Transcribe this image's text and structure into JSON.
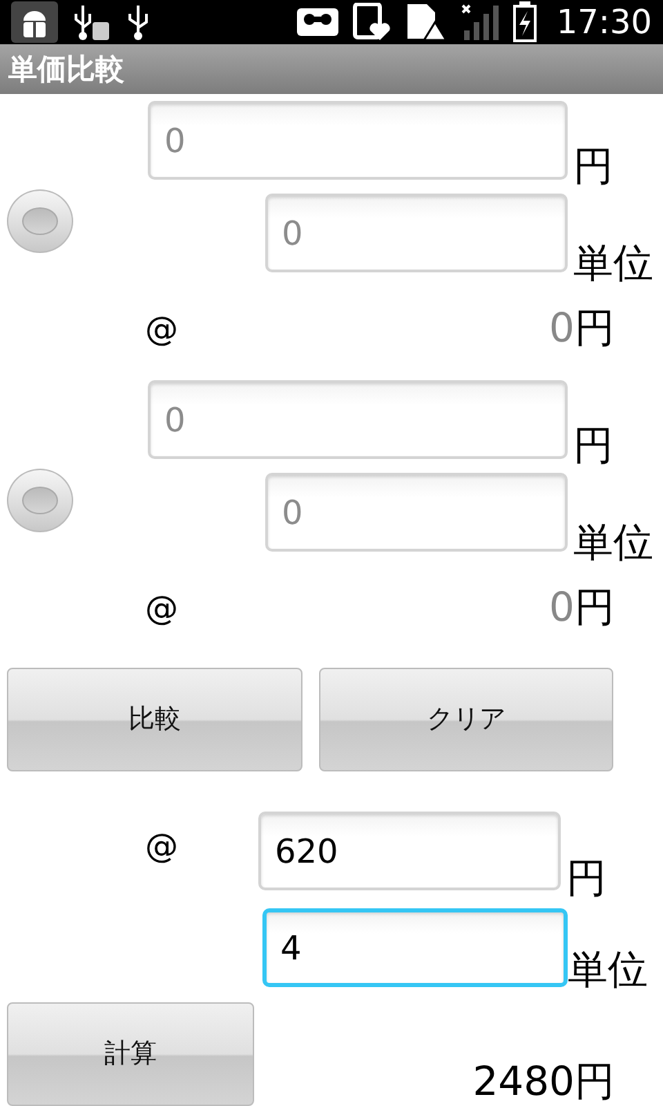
{
  "status_bar": {
    "time": "17:30"
  },
  "title": "単価比較",
  "items": [
    {
      "price": {
        "placeholder": "0"
      },
      "price_unit": "円",
      "selected": false,
      "quantity": {
        "placeholder": "0"
      },
      "quantity_unit": "単位",
      "at": "@",
      "unit_price": "0",
      "unit_price_currency": "円"
    },
    {
      "price": {
        "placeholder": "0"
      },
      "price_unit": "円",
      "selected": false,
      "quantity": {
        "placeholder": "0"
      },
      "quantity_unit": "単位",
      "at": "@",
      "unit_price": "0",
      "unit_price_currency": "円"
    }
  ],
  "buttons": [
    {
      "label": "比較"
    },
    {
      "label": "クリア"
    }
  ],
  "calculator": {
    "at": "@",
    "price": {
      "value": "620",
      "focused": false
    },
    "price_unit": "円",
    "quantity": {
      "value": "4",
      "focused": true
    },
    "quantity_unit": "単位",
    "button": "計算",
    "total": "2480",
    "total_currency": "円"
  }
}
